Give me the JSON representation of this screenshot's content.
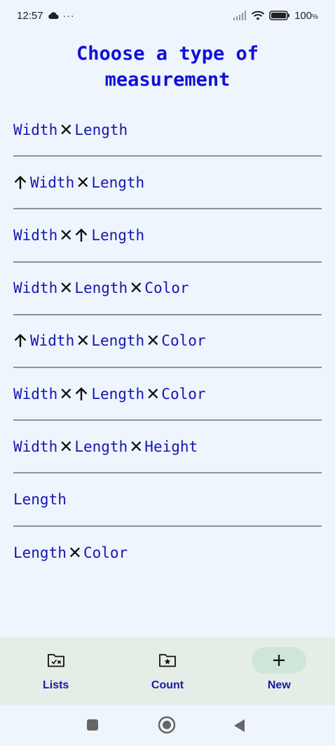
{
  "status": {
    "time": "12:57",
    "more": "···",
    "battery": "100",
    "battery_unit": "%"
  },
  "title": "Choose a type of measurement",
  "items": [
    {
      "parts": [
        {
          "t": "Width"
        },
        {
          "x": 1
        },
        {
          "t": "Length"
        }
      ]
    },
    {
      "parts": [
        {
          "up": 1
        },
        {
          "t": "Width"
        },
        {
          "x": 1
        },
        {
          "t": "Length"
        }
      ]
    },
    {
      "parts": [
        {
          "t": "Width"
        },
        {
          "x": 1
        },
        {
          "up": 1
        },
        {
          "t": "Length"
        }
      ]
    },
    {
      "parts": [
        {
          "t": "Width"
        },
        {
          "x": 1
        },
        {
          "t": "Length"
        },
        {
          "x": 1
        },
        {
          "t": "Color"
        }
      ]
    },
    {
      "parts": [
        {
          "up": 1
        },
        {
          "t": "Width"
        },
        {
          "x": 1
        },
        {
          "t": "Length"
        },
        {
          "x": 1
        },
        {
          "t": "Color"
        }
      ]
    },
    {
      "parts": [
        {
          "t": "Width"
        },
        {
          "x": 1
        },
        {
          "up": 1
        },
        {
          "t": "Length"
        },
        {
          "x": 1
        },
        {
          "t": "Color"
        }
      ]
    },
    {
      "parts": [
        {
          "t": "Width"
        },
        {
          "x": 1
        },
        {
          "t": "Length"
        },
        {
          "x": 1
        },
        {
          "t": "Height"
        }
      ]
    },
    {
      "parts": [
        {
          "t": "Length"
        }
      ]
    },
    {
      "parts": [
        {
          "t": "Length"
        },
        {
          "x": 1
        },
        {
          "t": "Color"
        }
      ]
    }
  ],
  "nav": {
    "lists_label": "Lists",
    "count_label": "Count",
    "new_label": "New",
    "active": "new"
  },
  "colors": {
    "accent": "#1010d8",
    "item_text": "#1616b0",
    "nav_bg": "#e4ede6",
    "nav_active": "#cde6d8"
  }
}
